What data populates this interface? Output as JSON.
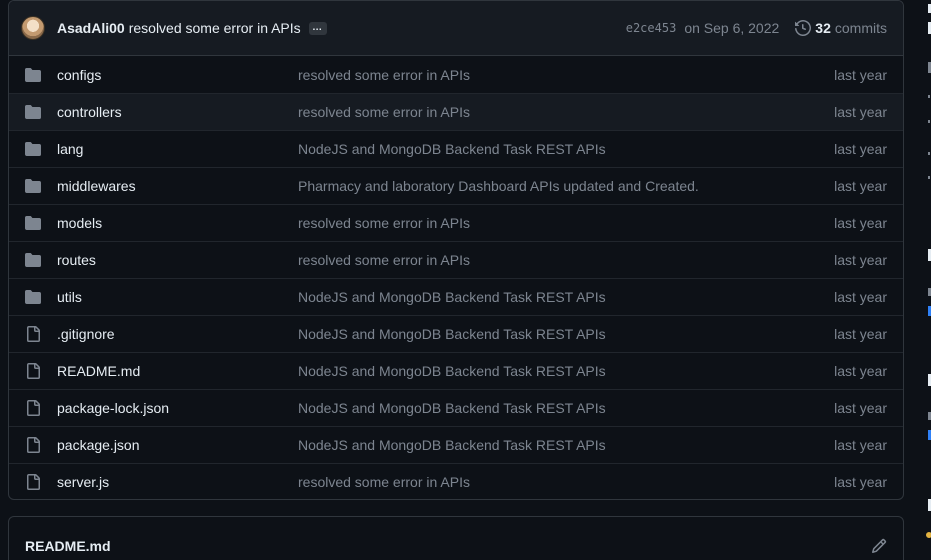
{
  "commit": {
    "author": "AsadAli00",
    "message": "resolved some error in APIs",
    "ellipsis": "…",
    "sha": "e2ce453",
    "date": "on Sep 6, 2022",
    "count": "32",
    "count_label": "commits"
  },
  "files": [
    {
      "type": "folder",
      "name": "configs",
      "message": "resolved some error in APIs",
      "age": "last year"
    },
    {
      "type": "folder",
      "name": "controllers",
      "message": "resolved some error in APIs",
      "age": "last year"
    },
    {
      "type": "folder",
      "name": "lang",
      "message": "NodeJS and MongoDB Backend Task REST APIs",
      "age": "last year"
    },
    {
      "type": "folder",
      "name": "middlewares",
      "message": "Pharmacy and laboratory Dashboard APIs updated and Created.",
      "age": "last year"
    },
    {
      "type": "folder",
      "name": "models",
      "message": "resolved some error in APIs",
      "age": "last year"
    },
    {
      "type": "folder",
      "name": "routes",
      "message": "resolved some error in APIs",
      "age": "last year"
    },
    {
      "type": "folder",
      "name": "utils",
      "message": "NodeJS and MongoDB Backend Task REST APIs",
      "age": "last year"
    },
    {
      "type": "file",
      "name": ".gitignore",
      "message": "NodeJS and MongoDB Backend Task REST APIs",
      "age": "last year"
    },
    {
      "type": "file",
      "name": "README.md",
      "message": "NodeJS and MongoDB Backend Task REST APIs",
      "age": "last year"
    },
    {
      "type": "file",
      "name": "package-lock.json",
      "message": "NodeJS and MongoDB Backend Task REST APIs",
      "age": "last year"
    },
    {
      "type": "file",
      "name": "package.json",
      "message": "NodeJS and MongoDB Backend Task REST APIs",
      "age": "last year"
    },
    {
      "type": "file",
      "name": "server.js",
      "message": "resolved some error in APIs",
      "age": "last year"
    }
  ],
  "readme": {
    "title": "README.md"
  },
  "colors": {
    "background": "#0d1117",
    "header_bg": "#161b22",
    "border": "#30363d",
    "text": "#e6edf3",
    "muted": "#7d8590",
    "icon": "#7d8590"
  },
  "icons": {
    "folder": "folder-icon",
    "file": "file-icon",
    "history": "history-icon",
    "edit": "pencil-icon"
  }
}
